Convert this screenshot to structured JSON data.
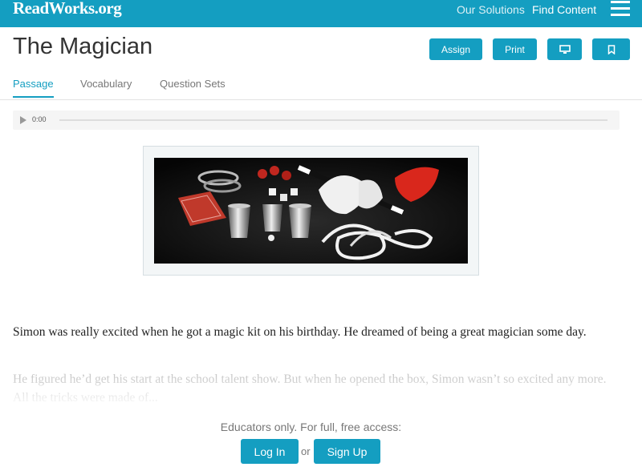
{
  "header": {
    "logo": "ReadWorks.org",
    "nav": [
      "Our Solutions",
      "Find Content"
    ],
    "brand_color": "#149ec1"
  },
  "article": {
    "title": "The Magician",
    "buttons": {
      "assign": "Assign",
      "print": "Print",
      "present_icon": "monitor-icon",
      "bookmark_icon": "bookmark-icon"
    },
    "tabs": [
      {
        "label": "Passage",
        "active": true
      },
      {
        "label": "Vocabulary",
        "active": false
      },
      {
        "label": "Question Sets",
        "active": false
      }
    ]
  },
  "audio": {
    "time": "0:00"
  },
  "passage": {
    "paragraphs": [
      "Simon was really excited when he got a magic kit on his birthday. He dreamed of being a great magician some day.",
      "He figured he’d get his start at the school talent show. But when he opened the box, Simon wasn’t so excited any more. All the tricks were made of..."
    ]
  },
  "access": {
    "message": "Educators only. For full, free access:",
    "login": "Log In",
    "or": "or",
    "signup": "Sign Up"
  }
}
